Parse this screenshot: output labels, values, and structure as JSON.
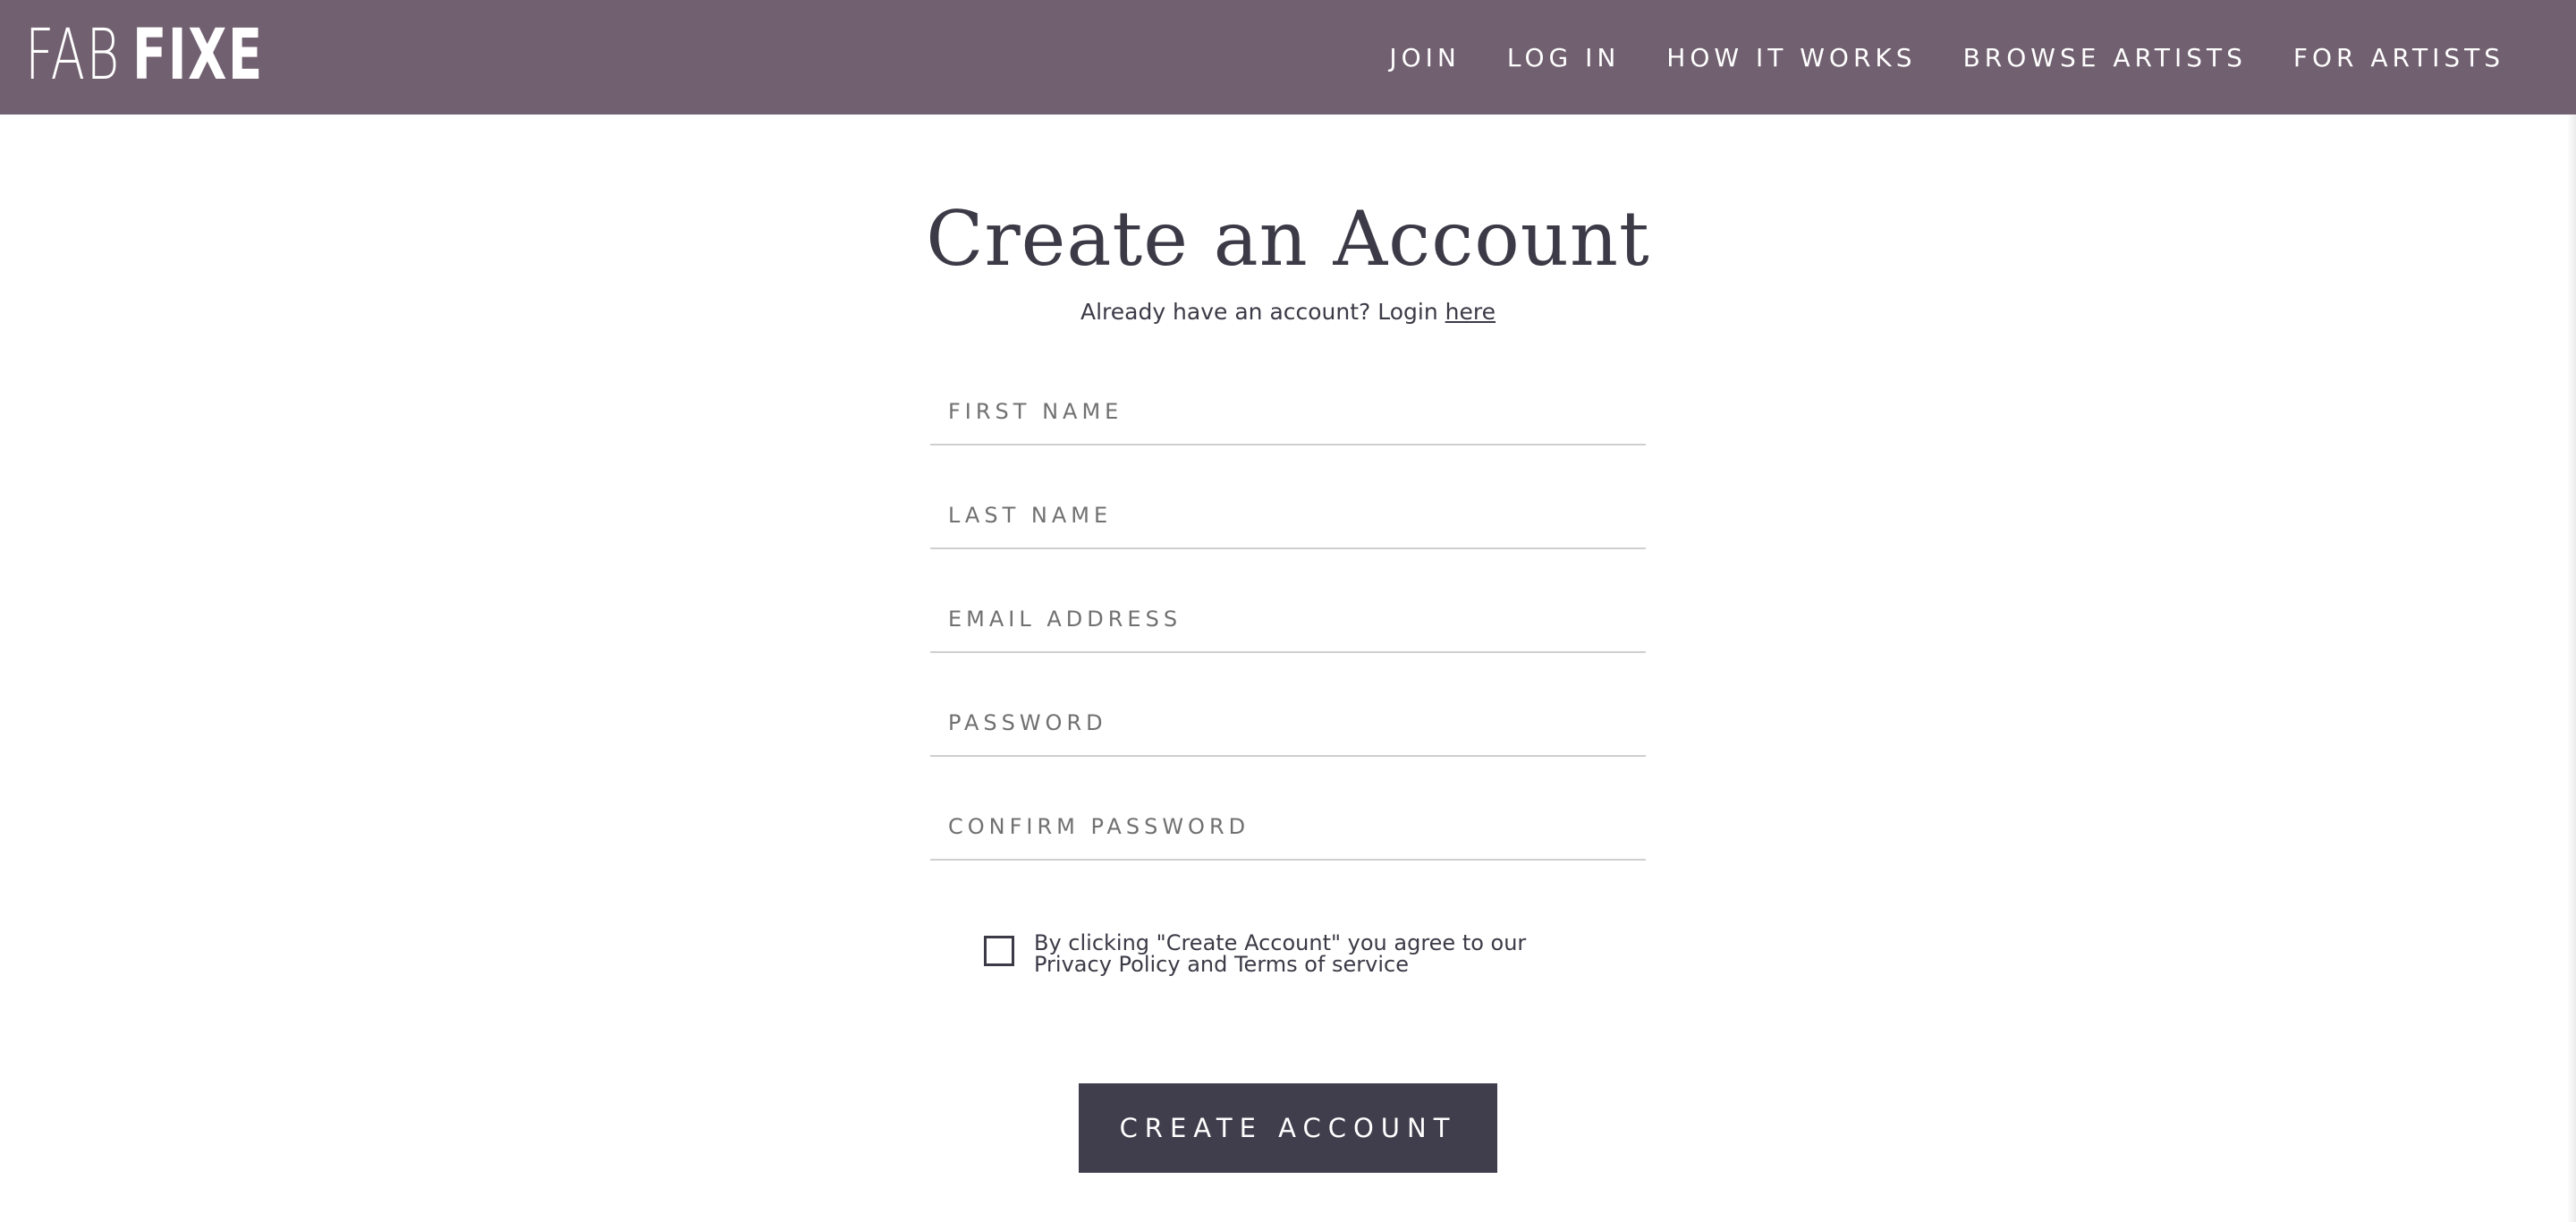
{
  "header": {
    "logo_light": "FAB",
    "logo_bold": "FIXE",
    "nav": [
      "JOIN",
      "LOG IN",
      "HOW IT WORKS",
      "BROWSE ARTISTS",
      "FOR ARTISTS"
    ]
  },
  "form": {
    "title": "Create an Account",
    "subtitle_text": "Already have an account? Login ",
    "subtitle_link": "here",
    "fields": {
      "first_name": "FIRST NAME",
      "last_name": "LAST NAME",
      "email": "EMAIL ADDRESS",
      "password": "PASSWORD",
      "confirm_password": "CONFIRM PASSWORD"
    },
    "consent_text": "By clicking \"Create Account\" you agree to our Privacy Policy and Terms of service",
    "submit_label": "CREATE ACCOUNT"
  },
  "colors": {
    "header_bg": "#716070",
    "text_dark": "#3b3a46",
    "button_bg": "#403e4c"
  }
}
